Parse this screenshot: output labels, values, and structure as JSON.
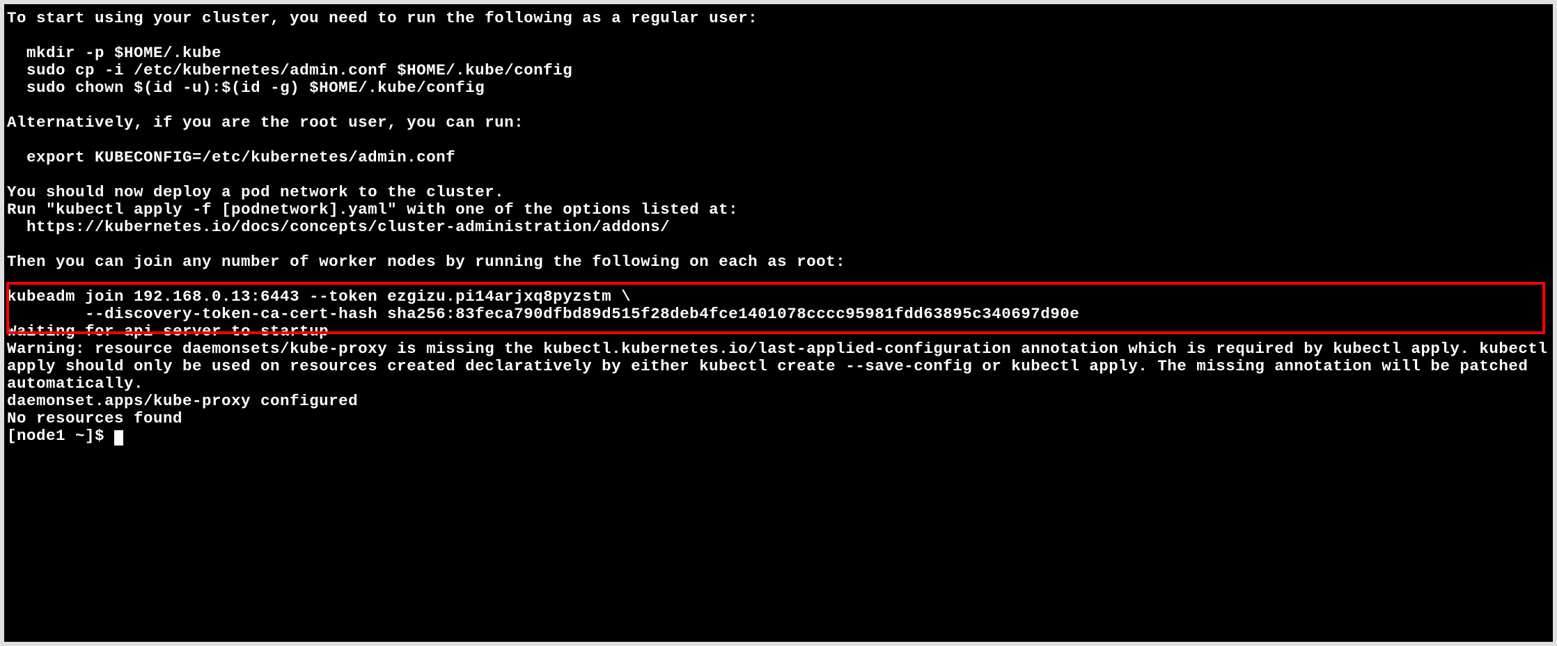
{
  "terminal": {
    "lines": {
      "instruction_intro": "To start using your cluster, you need to run the following as a regular user:",
      "blank1": "",
      "cmd_mkdir": "  mkdir -p $HOME/.kube",
      "cmd_cp": "  sudo cp -i /etc/kubernetes/admin.conf $HOME/.kube/config",
      "cmd_chown": "  sudo chown $(id -u):$(id -g) $HOME/.kube/config",
      "blank2": "",
      "alt_intro": "Alternatively, if you are the root user, you can run:",
      "blank3": "",
      "cmd_export": "  export KUBECONFIG=/etc/kubernetes/admin.conf",
      "blank4": "",
      "deploy_msg": "You should now deploy a pod network to the cluster.",
      "run_msg": "Run \"kubectl apply -f [podnetwork].yaml\" with one of the options listed at:",
      "url": "  https://kubernetes.io/docs/concepts/cluster-administration/addons/",
      "blank5": "",
      "join_intro": "Then you can join any number of worker nodes by running the following on each as root:",
      "blank6": "",
      "join_cmd1": "kubeadm join 192.168.0.13:6443 --token ezgizu.pi14arjxq8pyzstm \\",
      "join_cmd2": "        --discovery-token-ca-cert-hash sha256:83feca790dfbd89d515f28deb4fce1401078cccc95981fdd63895c340697d90e ",
      "waiting": "Waiting for api server to startup",
      "warning": "Warning: resource daemonsets/kube-proxy is missing the kubectl.kubernetes.io/last-applied-configuration annotation which is required by kubectl apply. kubectl apply should only be used on resources created declaratively by either kubectl create --save-config or kubectl apply. The missing annotation will be patched automatically.",
      "daemonset": "daemonset.apps/kube-proxy configured",
      "nores": "No resources found",
      "prompt": "[node1 ~]$ "
    }
  }
}
